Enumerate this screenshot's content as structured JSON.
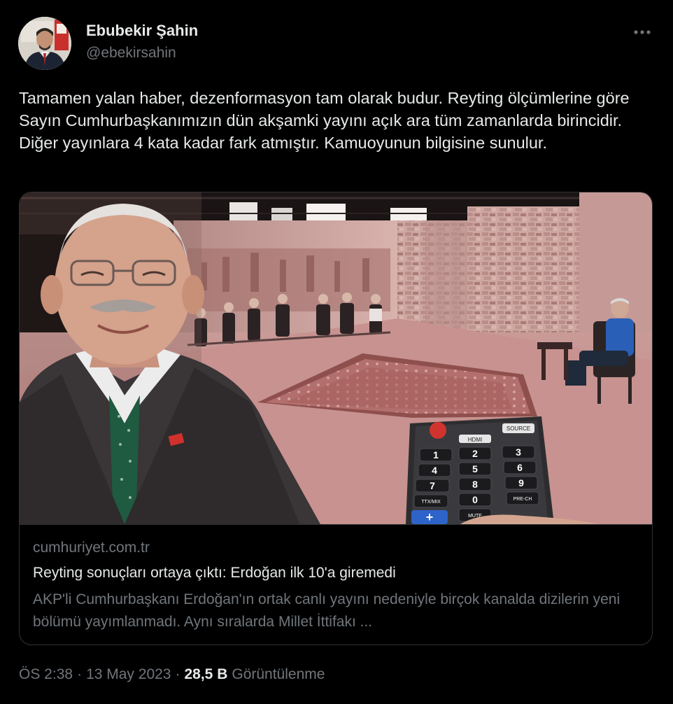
{
  "tweet": {
    "author": {
      "display_name": "Ebubekir Şahin",
      "handle": "@ebekirsahin"
    },
    "more_icon": "more-horizontal-icon",
    "text": "Tamamen yalan haber, dezenformasyon tam olarak budur. Reyting ölçümlerine göre Sayın Cumhurbaşkanımızın dün akşamki yayını açık ara tüm zamanlarda birincidir. Diğer yayınlara 4 kata kadar fark atmıştır. Kamuoyunun bilgisine sunulur.",
    "card": {
      "domain": "cumhuriyet.com.tr",
      "title": "Reyting sonuçları ortaya çıktı: Erdoğan ilk 10'a giremedi",
      "description": "AKP'li Cumhurbaşkanı Erdoğan'ın ortak canlı yayını nedeniyle birçok kanalda dizilerin yeni bölümü yayımlanmadı. Aynı sıralarda Millet İttifakı ...",
      "remote_labels": {
        "hdmi": "HDMI",
        "source": "SOURCE",
        "ttx": "TTX/MIX",
        "prech": "PRE-CH",
        "mute": "MUTE",
        "keys": [
          "1",
          "2",
          "3",
          "4",
          "5",
          "6",
          "7",
          "8",
          "9",
          "0",
          "+"
        ]
      }
    },
    "meta": {
      "time": "ÖS 2:38",
      "separator": "·",
      "date": "13 May 2023",
      "views_count": "28,5 B",
      "views_label": "Görüntülenme"
    }
  },
  "colors": {
    "background": "#000000",
    "primary_text": "#e7e9ea",
    "secondary_text": "#71767b",
    "border": "#2f3336"
  }
}
